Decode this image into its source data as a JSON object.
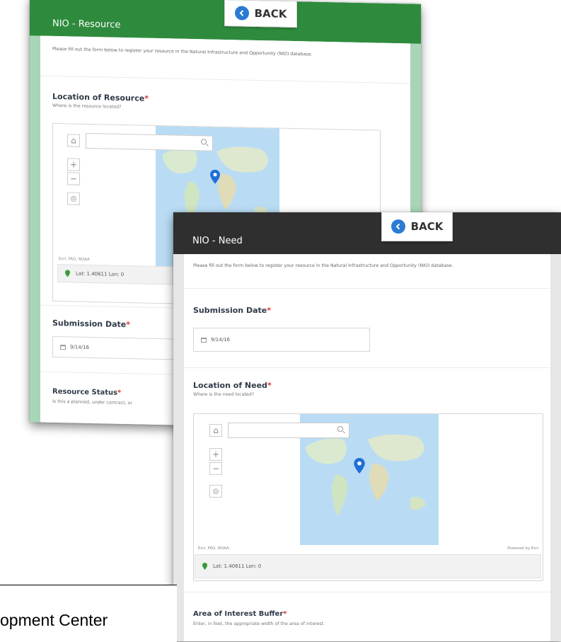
{
  "colors": {
    "resource_banner": "#2e8b3d",
    "resource_frame": "#a8d5b6",
    "need_banner": "#2f2f2f",
    "need_frame": "#e6e6e6",
    "back_icon": "#2b7bd3",
    "map_pin": "#1f6fd6",
    "location_pin": "#3a9a3a"
  },
  "resource_form": {
    "title": "NIO - Resource",
    "back_label": "BACK",
    "intro": "Please fill out the form below to register your resource in the Natural Infrastructure and Opportunity (NIO) database.",
    "location": {
      "title": "Location of Resource",
      "required_mark": "*",
      "help": "Where is the resource located?",
      "attribution": "Esri, FAO, NOAA",
      "coords": "Lat: 1.40611 Lon: 0"
    },
    "submission": {
      "title": "Submission Date",
      "required_mark": "*",
      "date": "9/14/16"
    },
    "status": {
      "title": "Resource Status",
      "required_mark": "*",
      "help": "Is this a planned, under contract, or"
    }
  },
  "need_form": {
    "title": "NIO - Need",
    "back_label": "BACK",
    "intro": "Please fill out the form below to register your resource in the Natural Infrastructure and Opportunity (NIO) database.",
    "submission": {
      "title": "Submission Date",
      "required_mark": "*",
      "date": "9/14/16"
    },
    "location": {
      "title": "Location of Need",
      "required_mark": "*",
      "help": "Where is the need located?",
      "attribution": "Esri, FAO, NOAA",
      "powered_by": "Powered by Esri",
      "coords": "Lat: 1.40611 Lon: 0"
    },
    "buffer": {
      "title": "Area of Interest Buffer",
      "required_mark": "*",
      "help": "Enter, in feet, the appropriate width of the area of interest."
    }
  },
  "footer_caption": "opment Center"
}
